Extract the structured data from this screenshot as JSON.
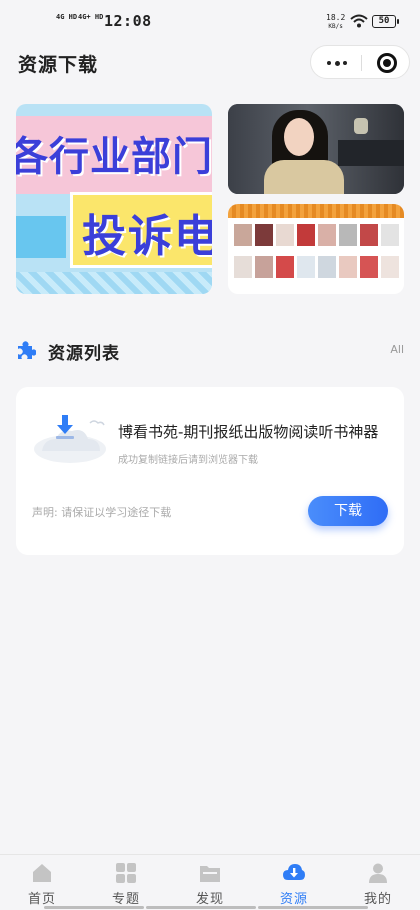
{
  "status_bar": {
    "signal1": "4G HD",
    "signal2": "4G+ HD",
    "time": "12:08",
    "speed": "18.2",
    "speed_unit": "KB/s",
    "battery": "50"
  },
  "header": {
    "title": "资源下载"
  },
  "section": {
    "title": "资源列表",
    "all_label": "All"
  },
  "banner": {
    "text_line1": "各行业部门",
    "text_line2": "投诉电"
  },
  "resource": {
    "title": "博看书苑-期刊报纸出版物阅读听书神器",
    "subtitle": "成功复制链接后请到浏览器下载",
    "note": "声明: 请保证以学习途径下载",
    "download_label": "下载"
  },
  "tabbar": {
    "active_color": "#2f7df6",
    "items": [
      {
        "label": "首页",
        "icon": "home-icon"
      },
      {
        "label": "专题",
        "icon": "grid-icon"
      },
      {
        "label": "发现",
        "icon": "folder-icon"
      },
      {
        "label": "资源",
        "icon": "cloud-download-icon"
      },
      {
        "label": "我的",
        "icon": "user-icon"
      }
    ]
  }
}
